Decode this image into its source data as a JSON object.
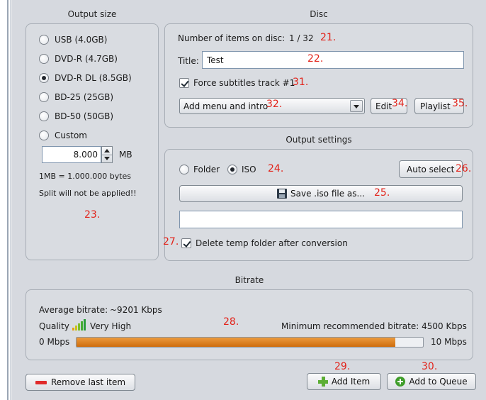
{
  "output_size": {
    "title": "Output size",
    "options": [
      {
        "label": "USB (4.0GB)",
        "selected": false
      },
      {
        "label": "DVD-R (4.7GB)",
        "selected": false
      },
      {
        "label": "DVD-R DL (8.5GB)",
        "selected": true
      },
      {
        "label": "BD-25 (25GB)",
        "selected": false
      },
      {
        "label": "BD-50 (50GB)",
        "selected": false
      },
      {
        "label": "Custom",
        "selected": false
      }
    ],
    "custom_value": "8.000",
    "custom_unit": "MB",
    "info_bytes": "1MB = 1.000.000 bytes",
    "info_split": "Split will not be applied!!",
    "annotation": "23."
  },
  "disc": {
    "title": "Disc",
    "items_label": "Number of items on disc:",
    "items_value": "1 / 32",
    "items_annotation": "21.",
    "title_label": "Title:",
    "title_value": "Test",
    "title_annotation": "22.",
    "force_subtitles_label": "Force subtitles track #1",
    "force_subtitles_checked": true,
    "force_annotation": "31.",
    "menu_select_value": "Add menu and intro",
    "menu_annotation": "32.",
    "edit_label": "Edit",
    "edit_annotation": "34.",
    "playlist_label": "Playlist",
    "playlist_annotation": "35."
  },
  "output_settings": {
    "title": "Output settings",
    "folder_label": "Folder",
    "iso_label": "ISO",
    "selected": "ISO",
    "mode_annotation": "24.",
    "auto_select_label": "Auto select",
    "auto_annotation": "26.",
    "save_label": "Save .iso file as...",
    "save_annotation": "25.",
    "path_value": "",
    "delete_temp_label": "Delete temp folder after conversion",
    "delete_temp_checked": true,
    "delete_annotation": "27."
  },
  "bitrate": {
    "title": "Bitrate",
    "average_label": "Average bitrate:",
    "average_value": "~9201  Kbps",
    "quality_label": "Quality",
    "quality_value": "Very High",
    "annotation": "28.",
    "min_recommended": "Minimum recommended bitrate: 4500 Kbps",
    "min_label": "0 Mbps",
    "max_label": "10 Mbps",
    "fill_fraction": 0.9201
  },
  "footer": {
    "remove_label": "Remove last item",
    "add_item_label": "Add Item",
    "add_item_annotation": "29.",
    "add_queue_label": "Add to Queue",
    "add_queue_annotation": "30."
  },
  "colors": {
    "progress_fill": "#d97b17",
    "annotation": "#e2231a",
    "remove_icon": "#e02b2b",
    "add_icon": "#5cae35",
    "queue_icon": "#3f9d2a"
  },
  "icons": {
    "save": "floppy-disk-icon",
    "quality": "signal-bars-icon",
    "remove": "minus-icon",
    "add": "plus-icon",
    "queue": "circle-plus-icon"
  }
}
